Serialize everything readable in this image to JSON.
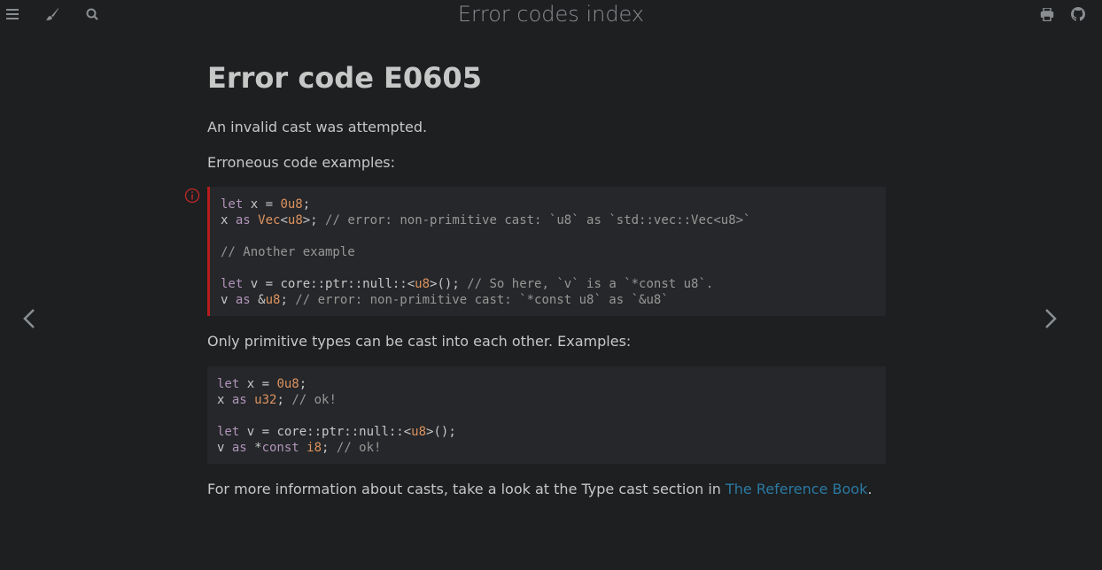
{
  "topbar": {
    "title": "Error codes index",
    "icons": [
      "menu-icon",
      "paintbrush-icon",
      "search-icon",
      "print-icon",
      "github-icon"
    ]
  },
  "page": {
    "heading": "Error code E0605",
    "intro": "An invalid cast was attempted.",
    "erroneous_label": "Erroneous code examples:",
    "primitive_label": "Only primitive types can be cast into each other. Examples:",
    "more_info_prefix": "For more information about casts, take a look at the Type cast section in ",
    "more_info_link": "The Reference Book",
    "more_info_suffix": "."
  },
  "code_error": [
    "let x = 0u8;",
    "x as Vec<u8>; // error: non-primitive cast: `u8` as `std::vec::Vec<u8>`",
    "",
    "// Another example",
    "",
    "let v = core::ptr::null::<u8>(); // So here, `v` is a `*const u8`.",
    "v as &u8; // error: non-primitive cast: `*const u8` as `&u8`"
  ],
  "code_ok": [
    "let x = 0u8;",
    "x as u32; // ok!",
    "",
    "let v = core::ptr::null::<u8>();",
    "v as *const i8; // ok!"
  ],
  "colors": {
    "background": "#1d1f21",
    "code_background": "#25272a",
    "error_border": "#b71c1c",
    "link": "#2b79a2"
  }
}
